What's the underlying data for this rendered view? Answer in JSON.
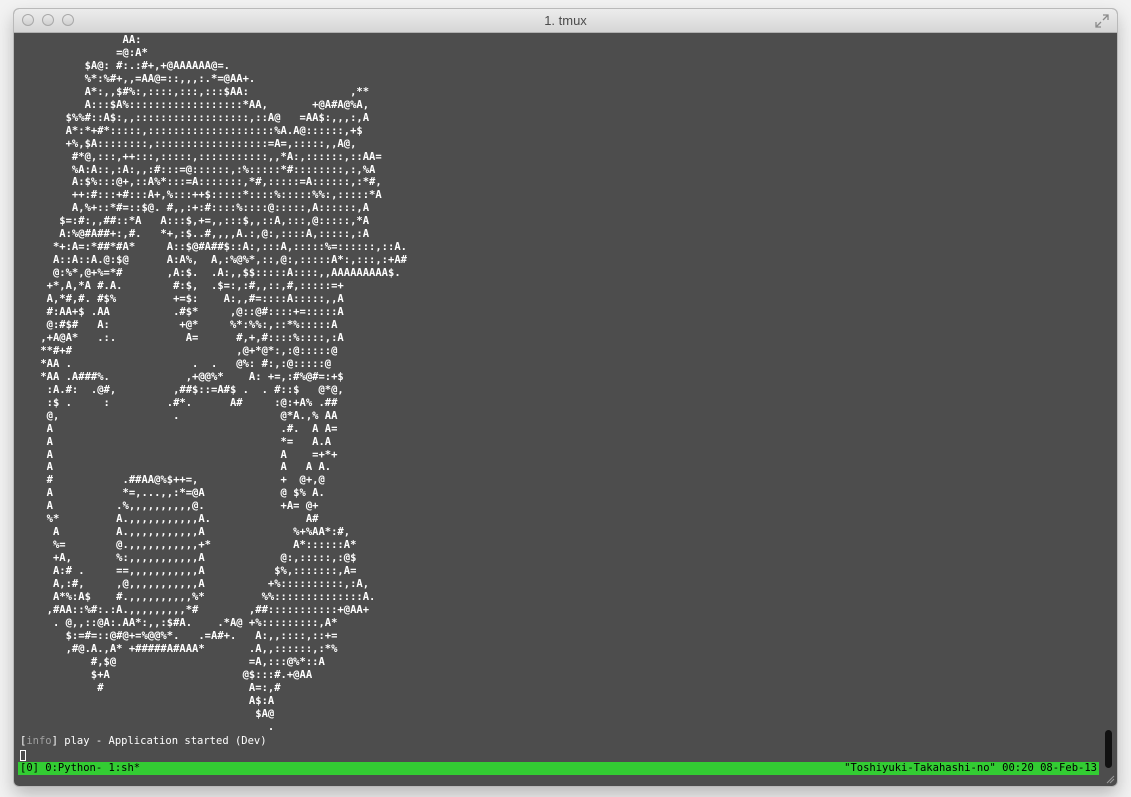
{
  "window": {
    "title": "1. tmux"
  },
  "terminal": {
    "ascii_art": "              AA:\n             =@:A*\n        $A@: #:.:#+,+@AAAAAA@=.\n        %*:%#+,,=AA@=::,,,:.*=@AA+.\n        A*:,,$#%:,::::,:::,:::$AA:                ,**\n        A:::$A%::::::::::::::::::*AA,       +@A#A@%A,\n     $%%#::A$:,,::::::::::::::::::,::A@   =AA$:,,,:,A\n     A*:*+#*:::::,::::::::::::::::::::%A.A@::::::,+$\n     +%,$A::::::::,::::::::::::::::::=A=,:::::,,A@,\n      #*@,:::,++:::,:::::,:::::::::::,,*A:,::::::,::AA=\n      %A:A::,:A:,,:#:::=@::::::,:%:::::*#::::::::,:,%A\n      A:$%:::@+,::A%*:::=A:::::::,*#,:::::=A::::::,:*#,\n      ++:#:::+#:::A+,%:::++$:::::*::::%:::::%%:,:::::*A\n      A,%+::*#=::$@. #,,:+:#::::%::::@:::::,A::::::,A\n    $=:#:,,##::*A   A:::$,+=,,:::$,,::A,:::,@:::::,*A\n    A:%@#A##+:,#.   *+,:$..#,,,,A.:,@:,::::A,:::::,:A\n   *+:A=:*##*#A*     A::$@#A##$::A:,:::A,:::::%=::::::,::A.\n   A::A::A.@:$@      A:A%,  A,:%@%*,::,@:,:::::A*:,:::,:+A#\n   @:%*,@+%=*#       ,A:$.  .A:,,$$:::::A::::,,AAAAAAAAA$.\n  +*,A,*A #.A.        #:$,  .$=:,:#,,::,#,:::::=+\n  A,*#,#. #$%         +=$:    A:,,#=::::A:::::,,A\n  #:AA+$ .AA          .#$*     ,@::@#::::+=:::::A\n  @:#$#   A:           +@*     %*:%%:,::*%:::::A\n ,+A@A*   .:.           A=      #,+,#::::%::::,:A\n **#+#                          ,@+*@*:,:@:::::@\n *AA .                   .  .   @%: #:,:@:::::@\n *AA .A###%.            ,+@@%*    A: +=,:#%@#=:+$\n  :A.#:  .@#,         ,##$::=A#$ .  . #::$   @*@,\n  :$ .     :         .#*.      A#     :@:+A% .##\n  @,                  .                @*A.,% AA\n  A                                    .#.  A A=\n  A                                    *=   A.A\n  A                                    A    =+*+\n  A                                    A   A A.\n  #           .##AA@%$++=,             +  @+,@\n  A           *=,...,,:*=@A            @ $% A.\n  A          .%,,,,,,,,,,@.            +A= @+\n  %*         A.,,,,,,,,,,,A.               A#\n   A         A.,,,,,,,,,,,A              %+%AA*:#,\n   %=        @.,,,,,,,,,,,+*             A*::::::A*\n   +A,       %:,,,,,,,,,,,A            @:,:::::,:@$\n   A:# .     ==,,,,,,,,,,,A           $%,:::::::,A=\n   A,:#,     ,@,,,,,,,,,,,A          +%::::::::::,:A,\n   A*%:A$    #.,,,,,,,,,,%*         %%::::::::::::::A.\n  ,#AA::%#:.:A.,,,,,,,,,*#        ,##:::::::::::+@AA+\n   . @,,::@A:.AA*:,,:$#A.    .*A@ +%:::::::::,A*\n     $:=#=::@#@+=%@@%*.   .=A#+.   A:,,::::,::+=\n     ,#@.A.,A* +#####A#AAA*       .A,,::::::,:*%\n         #,$@                     =A,:::@%*::A\n         $+A                     @$:::#.+@AA\n          #                       A=:,#\n                                  A$:A\n                                   $A@\n                                     ."
  },
  "log": {
    "tag": "info",
    "message": " play - Application started (Dev)"
  },
  "statusbar": {
    "left": "[0] 0:Python- 1:sh*",
    "right": "\"Toshiyuki-Takahashi-no\" 00:20 08-Feb-13"
  },
  "colors": {
    "status_green": "#33cc33",
    "terminal_bg": "#4d4d4d"
  },
  "icons": {
    "fullscreen": "fullscreen-icon",
    "resize": "resize-grip-icon"
  }
}
